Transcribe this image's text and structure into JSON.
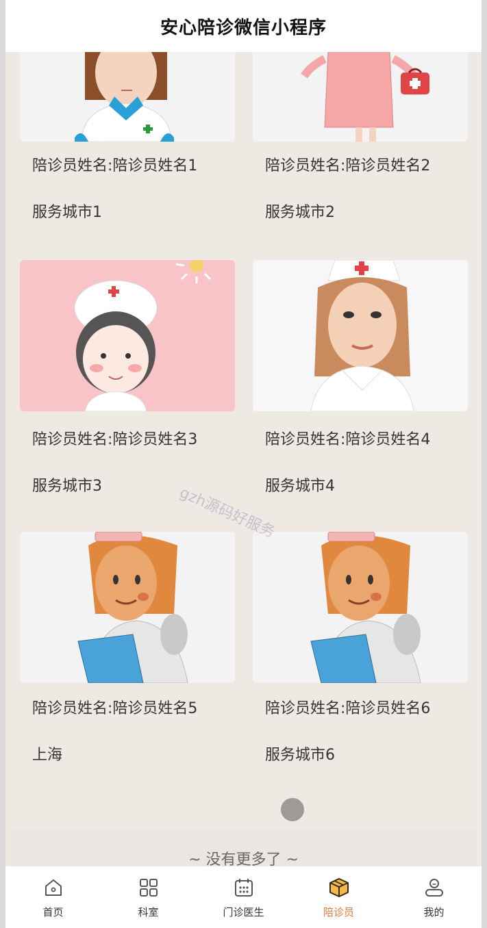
{
  "header": {
    "title": "安心陪诊微信小程序"
  },
  "companions": [
    {
      "name_label": "陪诊员姓名:陪诊员姓名1",
      "city": "服务城市1"
    },
    {
      "name_label": "陪诊员姓名:陪诊员姓名2",
      "city": "服务城市2"
    },
    {
      "name_label": "陪诊员姓名:陪诊员姓名3",
      "city": "服务城市3"
    },
    {
      "name_label": "陪诊员姓名:陪诊员姓名4",
      "city": "服务城市4"
    },
    {
      "name_label": "陪诊员姓名:陪诊员姓名5",
      "city": "上海"
    },
    {
      "name_label": "陪诊员姓名:陪诊员姓名6",
      "city": "服务城市6"
    }
  ],
  "footer": {
    "end_text": "~ 没有更多了 ~"
  },
  "watermark": "gzh源码好服务",
  "tabbar": {
    "items": [
      {
        "label": "首页",
        "icon": "home-icon"
      },
      {
        "label": "科室",
        "icon": "grid-icon"
      },
      {
        "label": "门诊医生",
        "icon": "calendar-icon"
      },
      {
        "label": "陪诊员",
        "icon": "box-icon",
        "active": true
      },
      {
        "label": "我的",
        "icon": "user-icon"
      }
    ],
    "active_color": "#e0793a"
  }
}
